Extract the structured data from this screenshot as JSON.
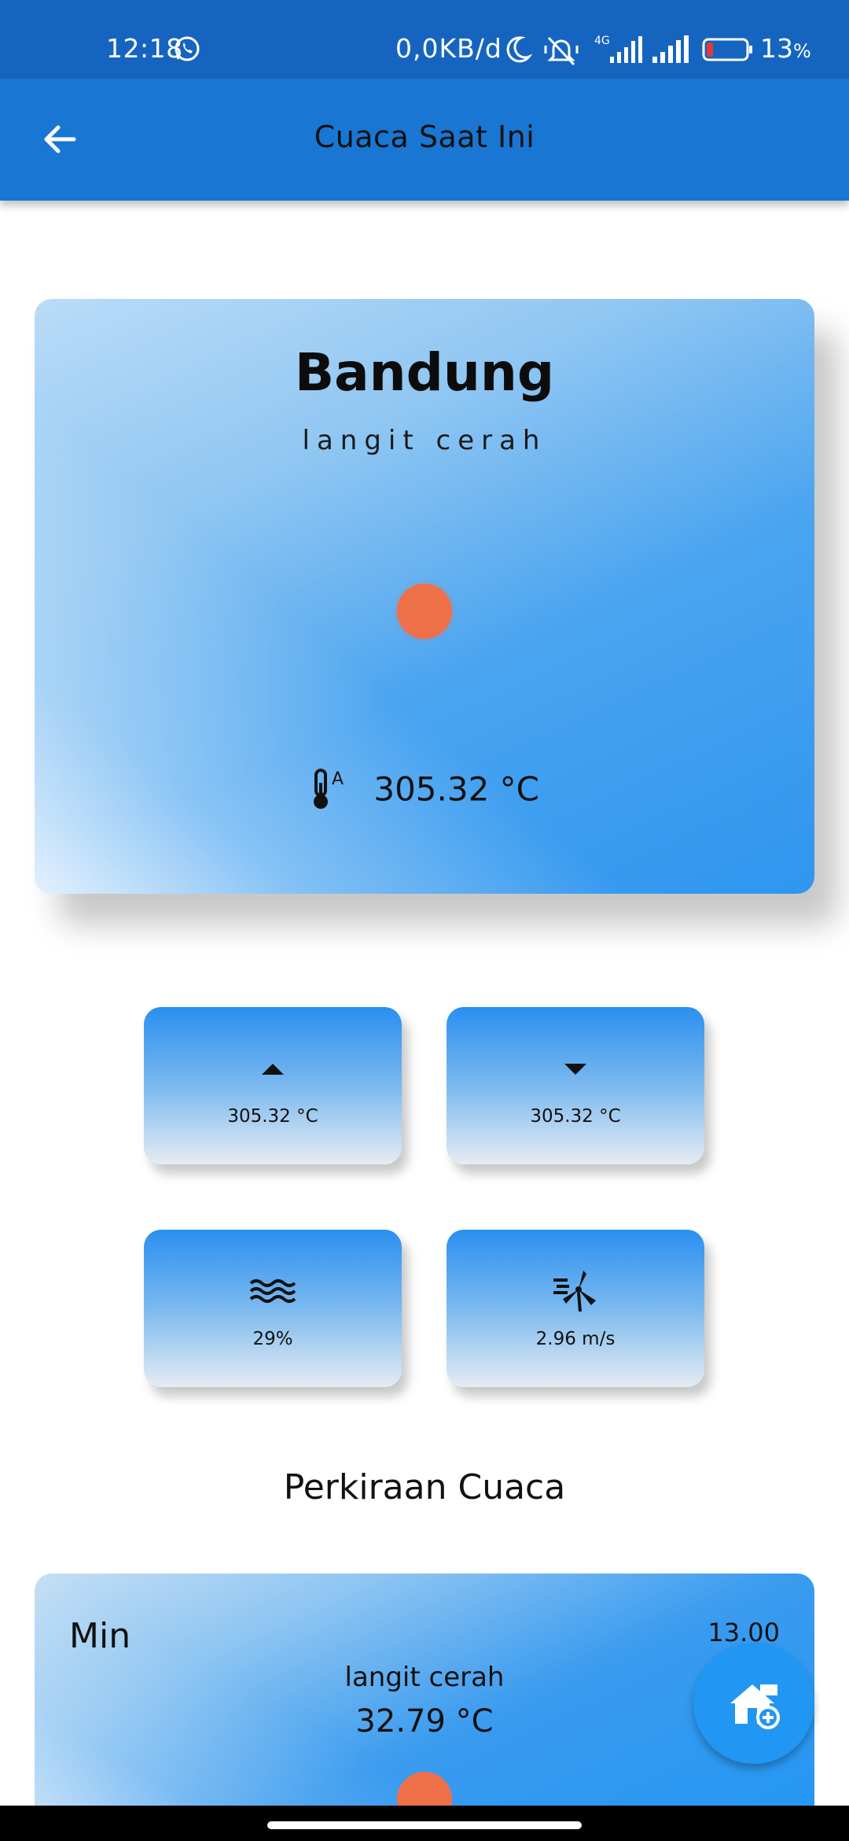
{
  "status_bar": {
    "time": "12:18",
    "net_speed": "0,0KB/d",
    "network_type": "4G",
    "battery_percent": "13",
    "battery_unit": "%",
    "icons": [
      "whatsapp-icon",
      "moon-icon",
      "mute-icon",
      "signal-4g-icon",
      "signal-icon",
      "battery-icon"
    ]
  },
  "app_bar": {
    "title": "Cuaca Saat Ini",
    "back_icon": "arrow-left-icon"
  },
  "current": {
    "city": "Bandung",
    "description": "langit cerah",
    "temperature": "305.32 °C",
    "weather_icon": "sun-icon",
    "sun_color": "#ee7049"
  },
  "stats": {
    "temp_max": "305.32 °C",
    "temp_min": "305.32 °C",
    "humidity": "29%",
    "wind_speed": "2.96 m/s"
  },
  "forecast": {
    "title": "Perkiraan Cuaca",
    "items": [
      {
        "label": "Min",
        "time": "13.00",
        "description": "langit cerah",
        "temperature": "32.79 °C"
      }
    ]
  },
  "fab": {
    "icon": "add-location-home-icon"
  },
  "colors": {
    "status_bar": "#1565c0",
    "app_bar": "#1976d2",
    "accent": "#2196f3"
  }
}
